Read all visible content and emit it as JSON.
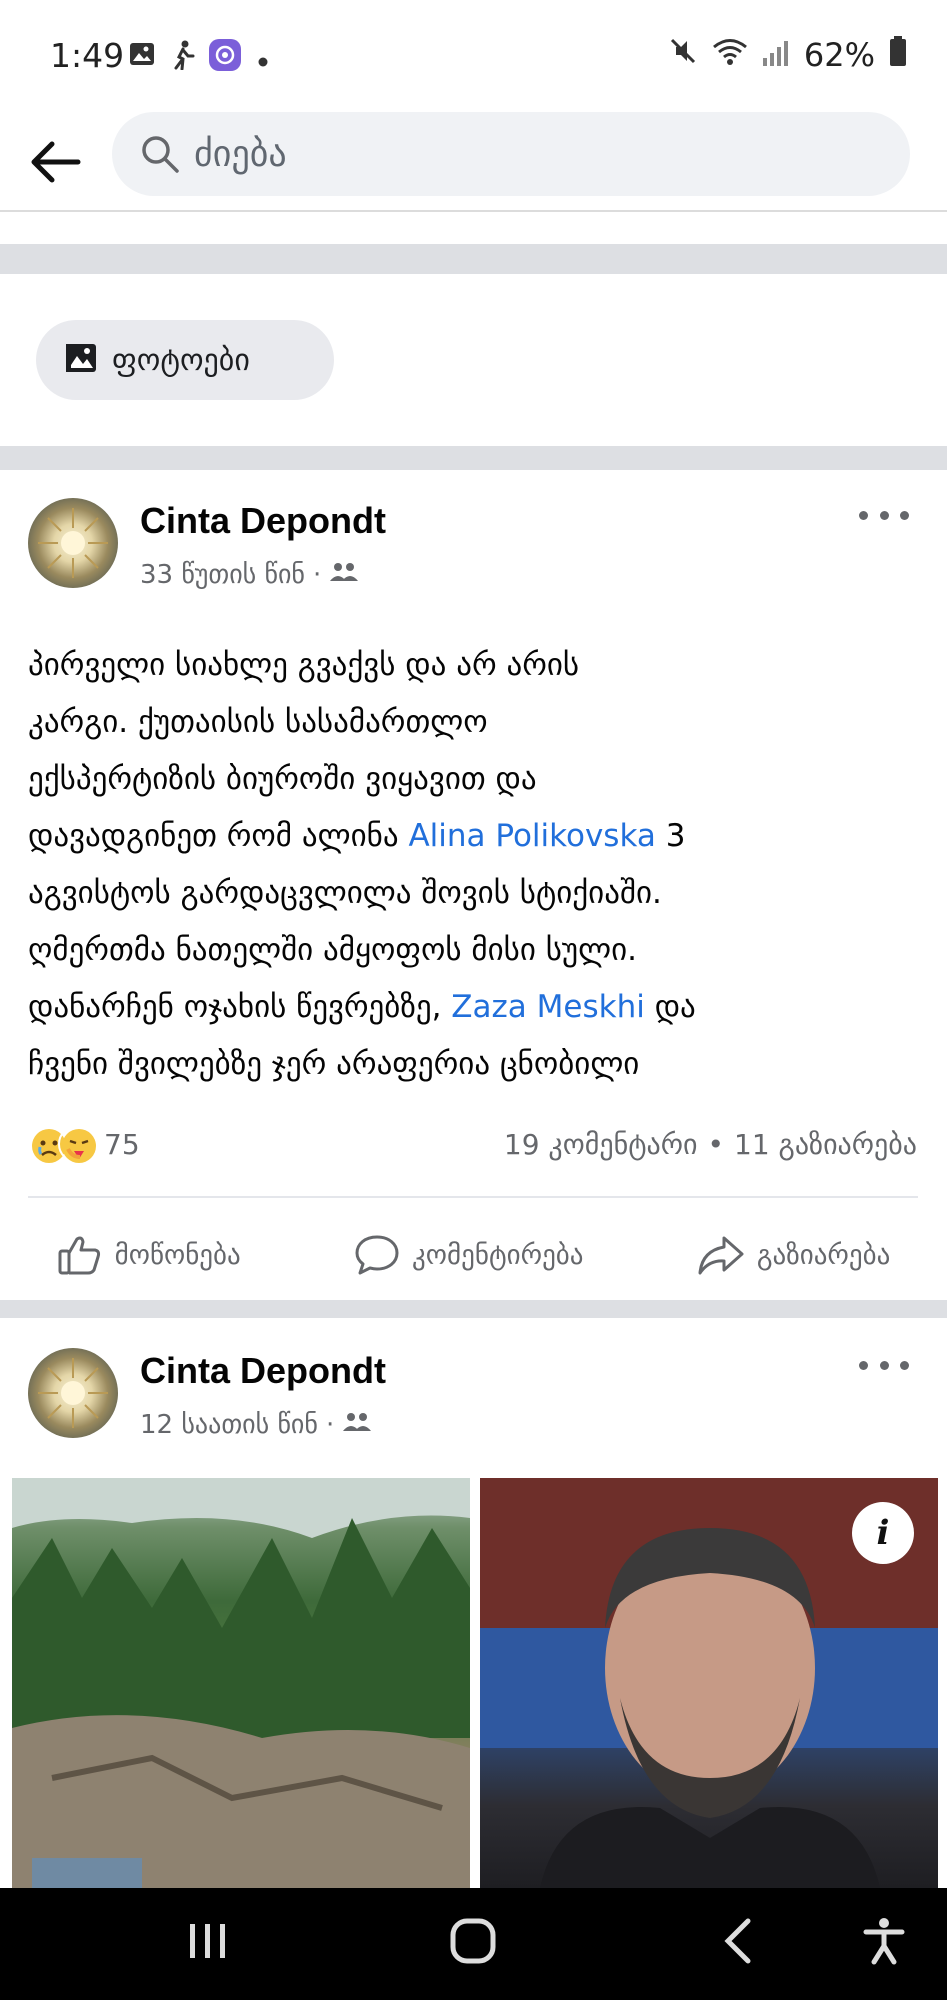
{
  "status_bar": {
    "time": "1:49",
    "battery": "62%",
    "icons": [
      "image-icon",
      "walking-icon",
      "app-icon",
      "dot-icon",
      "mute-icon",
      "wifi-icon",
      "signal-icon",
      "battery-icon"
    ]
  },
  "header": {
    "search_placeholder": "ძიება"
  },
  "photos_chip": {
    "label": "ფოტოები"
  },
  "post1": {
    "author": "Cinta Depondt",
    "time": "33 წუთის წინ",
    "text_lines": [
      "პირველი სიახლე გვაქვს და არ არის",
      "კარგი. ქუთაისის სასამართლო",
      "ექსპერტიზის ბიუროში ვიყავით და",
      "დავადგინეთ რომ ალინა ",
      "აგვისტოს გარდაცვლილა შოვის სტიქიაში.",
      "ღმერთმა ნათელში ამყოფოს მისი სული.",
      "დანარჩენ ოჯახის წევრებზე, ",
      "ჩვენი შვილებზე ჯერ არაფერია ცნობილი"
    ],
    "mention_1": "Alina Polikovska",
    "after_mention_1": " 3",
    "mention_2": "Zaza Meskhi",
    "after_mention_2": " და",
    "reaction_count": "75",
    "comments": "19 კომენტარი",
    "bullet": "•",
    "shares": "11 გაზიარება",
    "actions": {
      "like": "მოწონება",
      "comment": "კომენტირება",
      "share": "გაზიარება"
    }
  },
  "post2": {
    "author": "Cinta Depondt",
    "time": "12 საათის წინ",
    "info_label": "i"
  },
  "meta_dot": "·",
  "colors": {
    "mention": "#216fdb",
    "separator": "#dddfe3",
    "chip_bg": "#e9eaee",
    "search_bg": "#f0f2f5"
  }
}
